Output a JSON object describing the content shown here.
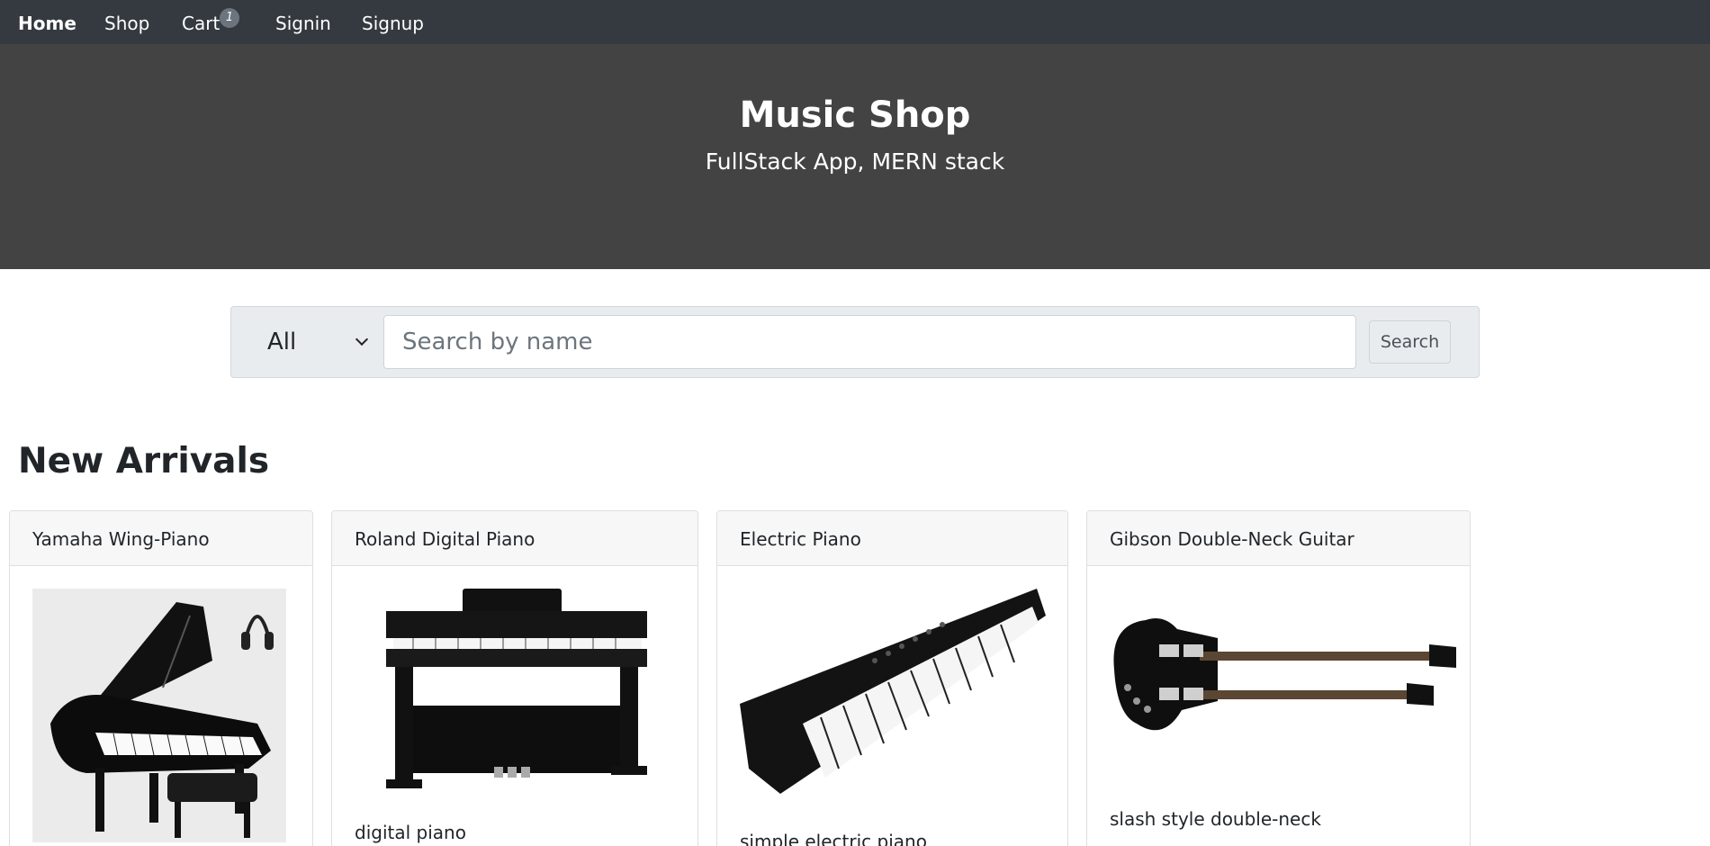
{
  "nav": {
    "items": [
      {
        "label": "Home",
        "active": true
      },
      {
        "label": "Shop",
        "active": false
      },
      {
        "label": "Cart",
        "active": false
      },
      {
        "label": "Signin",
        "active": false
      },
      {
        "label": "Signup",
        "active": false
      }
    ],
    "cart_count": "1"
  },
  "hero": {
    "title": "Music Shop",
    "subtitle": "FullStack App, MERN stack"
  },
  "search": {
    "category_selected": "All",
    "placeholder": "Search by name",
    "button_label": "Search"
  },
  "section": {
    "title": "New Arrivals"
  },
  "products": [
    {
      "name": "Yamaha Wing-Piano",
      "description": "",
      "image_icon": "grand-piano-image"
    },
    {
      "name": "Roland Digital Piano",
      "description": "digital piano",
      "image_icon": "digital-piano-image"
    },
    {
      "name": "Electric Piano",
      "description": "simple electric piano",
      "image_icon": "keyboard-image"
    },
    {
      "name": "Gibson Double-Neck Guitar",
      "description": "slash style double-neck",
      "image_icon": "guitar-image"
    }
  ],
  "colors": {
    "navbar": "#343a40",
    "hero": "#434343",
    "search_panel": "#e9ecef"
  }
}
